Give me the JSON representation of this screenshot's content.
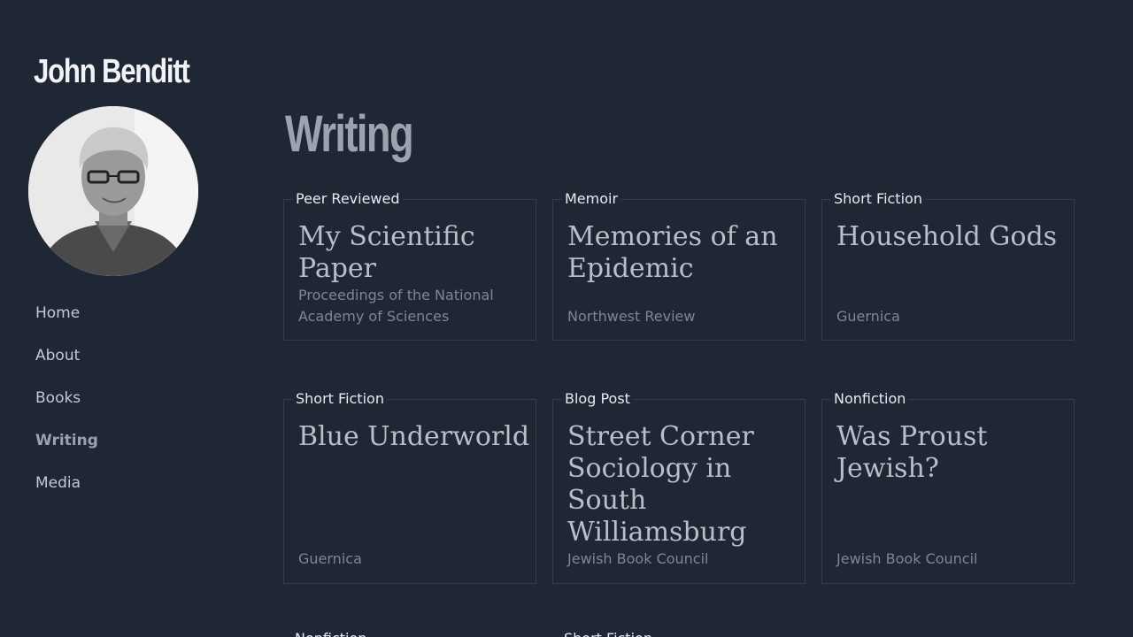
{
  "site": {
    "name": "John Benditt"
  },
  "nav": {
    "items": [
      {
        "label": "Home"
      },
      {
        "label": "About"
      },
      {
        "label": "Books"
      },
      {
        "label": "Writing"
      },
      {
        "label": "Media"
      }
    ]
  },
  "main": {
    "title": "Writing",
    "cards": [
      {
        "tag": "Peer Reviewed",
        "title": "My Scientific Paper",
        "publication": "Proceedings of the National Academy of Sciences"
      },
      {
        "tag": "Memoir",
        "title": "Memories of an Epidemic",
        "publication": "Northwest Review"
      },
      {
        "tag": "Short Fiction",
        "title": "Household Gods",
        "publication": "Guernica"
      },
      {
        "tag": "Short Fiction",
        "title": "Blue Underworld",
        "publication": "Guernica"
      },
      {
        "tag": "Blog Post",
        "title": "Street Corner Sociology in South Williamsburg",
        "publication": "Jewish Book Council"
      },
      {
        "tag": "Nonfiction",
        "title": "Was Proust Jewish?",
        "publication": "Jewish Book Council"
      }
    ],
    "next_row": [
      {
        "tag": "Nonfiction"
      },
      {
        "tag": "Short Fiction"
      }
    ]
  }
}
